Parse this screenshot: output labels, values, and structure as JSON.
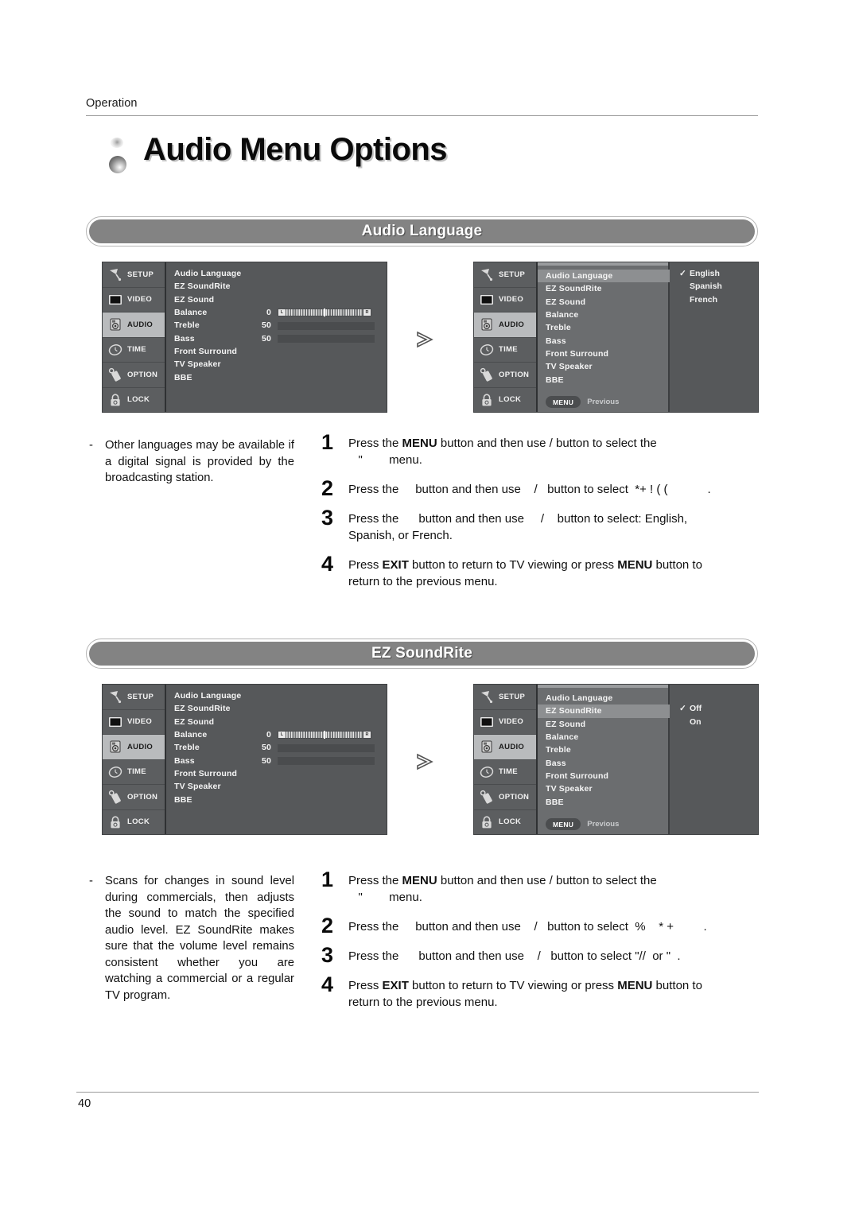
{
  "page": {
    "header_label": "Operation",
    "title": "Audio Menu Options",
    "page_number": "40"
  },
  "sections": [
    {
      "id": "audio-language",
      "banner": "Audio Language",
      "note": {
        "bullet": "-",
        "text": "Other languages may be available if a digital signal is provided by the broadcasting station."
      },
      "steps": [
        {
          "num": "1",
          "html": "Press  the  <b>MENU</b>  button  and  then  use        /         button  to  select  the <br>&nbsp;&nbsp;&nbsp;\"&nbsp;&nbsp;&nbsp;&nbsp;&nbsp;&nbsp;&nbsp;&nbsp;menu."
        },
        {
          "num": "2",
          "html": "Press the&nbsp;&nbsp;&nbsp;&nbsp;&nbsp;button and then use&nbsp;&nbsp;&nbsp;&nbsp;/&nbsp;&nbsp;&nbsp;button to select&nbsp;&nbsp;*+ ! ( (&nbsp;&nbsp;&nbsp;&nbsp;&nbsp;&nbsp;&nbsp;&nbsp;&nbsp;&nbsp;&nbsp;&nbsp;."
        },
        {
          "num": "3",
          "html": "Press  the&nbsp;&nbsp;&nbsp;&nbsp;&nbsp;&nbsp;button  and  then  use&nbsp;&nbsp;&nbsp;&nbsp;&nbsp;/&nbsp;&nbsp;&nbsp;&nbsp;button  to  select:  English, <br>Spanish, or French."
        },
        {
          "num": "4",
          "html": "Press  <b>EXIT</b>  button  to  return  to  TV  viewing  or  press  <b>MENU</b>  button  to <br>return to the previous menu."
        }
      ],
      "osd_left": {
        "menu_items": [
          "Audio Language",
          "EZ SoundRite",
          "EZ Sound",
          "Balance",
          "Treble",
          "Bass",
          "Front Surround",
          "TV Speaker",
          "BBE"
        ],
        "balance_value": "0",
        "treble_value": "50",
        "bass_value": "50",
        "balance_left_cap": "L",
        "balance_right_cap": "R"
      },
      "osd_right": {
        "menu_items": [
          "Audio Language",
          "EZ SoundRite",
          "EZ Sound",
          "Balance",
          "Treble",
          "Bass",
          "Front Surround",
          "TV Speaker",
          "BBE"
        ],
        "highlight_index": 0,
        "options": [
          "English",
          "Spanish",
          "French"
        ],
        "selected_index": 0,
        "check_glyph": "✓",
        "footer_pill": "MENU",
        "footer_label": "Previous"
      }
    },
    {
      "id": "ez-soundrite",
      "banner": "EZ SoundRite",
      "note": {
        "bullet": "-",
        "text": "Scans for changes in sound level during commercials, then adjusts the sound to match the specified audio level. EZ SoundRite makes sure that the volume level remains consistent whether you are watching a commercial or a regular TV program."
      },
      "steps": [
        {
          "num": "1",
          "html": "Press  the  <b>MENU</b>  button  and  then  use        /         button  to  select  the <br>&nbsp;&nbsp;&nbsp;\"&nbsp;&nbsp;&nbsp;&nbsp;&nbsp;&nbsp;&nbsp;&nbsp;menu."
        },
        {
          "num": "2",
          "html": "Press the&nbsp;&nbsp;&nbsp;&nbsp;&nbsp;button and then use&nbsp;&nbsp;&nbsp;&nbsp;/&nbsp;&nbsp;&nbsp;button to select&nbsp;&nbsp;%&nbsp;&nbsp;&nbsp;&nbsp;*&nbsp;+&nbsp;&nbsp;&nbsp;&nbsp;&nbsp;&nbsp;&nbsp;&nbsp;&nbsp;."
        },
        {
          "num": "3",
          "html": "Press the&nbsp;&nbsp;&nbsp;&nbsp;&nbsp;&nbsp;button and then use&nbsp;&nbsp;&nbsp;&nbsp;/&nbsp;&nbsp;&nbsp;button to select \"//&nbsp;&nbsp;or \"&nbsp;&nbsp;."
        },
        {
          "num": "4",
          "html": "Press  <b>EXIT</b>  button  to  return  to  TV  viewing  or  press  <b>MENU</b>  button  to <br>return to the previous menu."
        }
      ],
      "osd_left": {
        "menu_items": [
          "Audio Language",
          "EZ SoundRite",
          "EZ Sound",
          "Balance",
          "Treble",
          "Bass",
          "Front Surround",
          "TV Speaker",
          "BBE"
        ],
        "balance_value": "0",
        "treble_value": "50",
        "bass_value": "50",
        "balance_left_cap": "L",
        "balance_right_cap": "R"
      },
      "osd_right": {
        "menu_items": [
          "Audio Language",
          "EZ SoundRite",
          "EZ Sound",
          "Balance",
          "Treble",
          "Bass",
          "Front Surround",
          "TV Speaker",
          "BBE"
        ],
        "highlight_index": 1,
        "options": [
          "Off",
          "On"
        ],
        "selected_index": 0,
        "check_glyph": "✓",
        "footer_pill": "MENU",
        "footer_label": "Previous"
      }
    }
  ],
  "osd_sidebar": {
    "items": [
      {
        "label": "SETUP",
        "icon": "satellite-dish-icon"
      },
      {
        "label": "VIDEO",
        "icon": "tv-screen-icon"
      },
      {
        "label": "AUDIO",
        "icon": "speaker-icon",
        "active": true
      },
      {
        "label": "TIME",
        "icon": "clock-icon"
      },
      {
        "label": "OPTION",
        "icon": "remote-control-icon"
      },
      {
        "label": "LOCK",
        "icon": "padlock-icon"
      }
    ]
  },
  "colors": {
    "osd_bg": "#56585a",
    "osd_panel": "#6b6d6f",
    "osd_highlight": "#8d8f91",
    "banner_fill": "#838383",
    "rule": "#9a9a9a"
  }
}
